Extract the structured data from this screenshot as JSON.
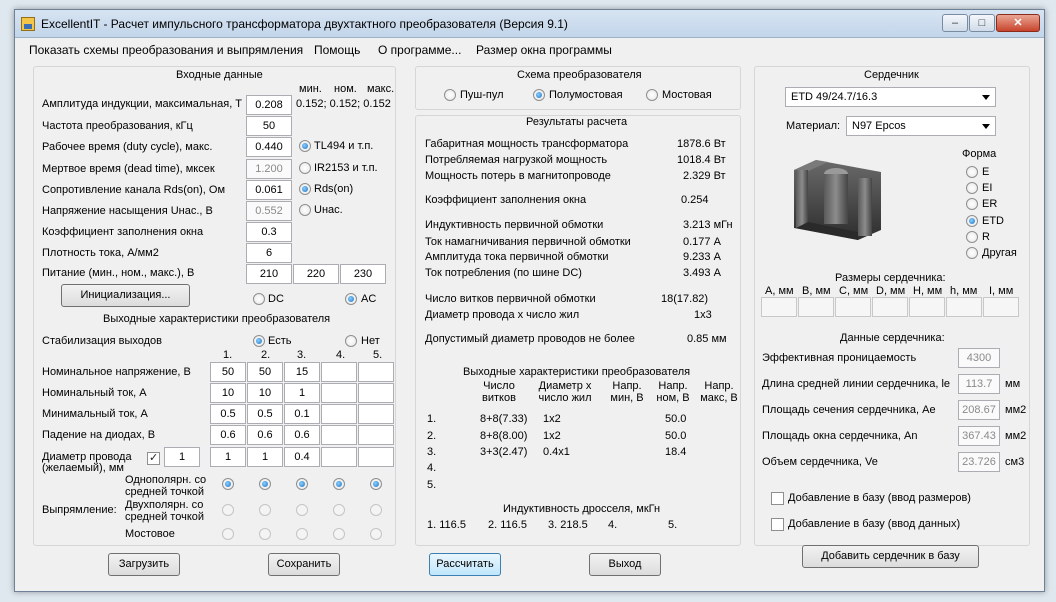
{
  "window": {
    "title": "ExcellentIT - Расчет импульсного трансформатора двухтактного преобразователя (Версия 9.1)"
  },
  "menu": [
    "Показать схемы преобразования и выпрямления",
    "Помощь",
    "О программе...",
    "Размер окна программы"
  ],
  "input": {
    "title": "Входные данные",
    "col_min": "мин.",
    "col_nom": "ном.",
    "col_max": "макс.",
    "rows": [
      {
        "label": "Амплитуда индукции, максимальная, T",
        "value": "0.208",
        "extra": "0.152; 0.152; 0.152"
      },
      {
        "label": "Частота преобразования, кГц",
        "value": "50"
      },
      {
        "label": "Рабочее время (duty cycle), макс.",
        "value": "0.440",
        "option": "TL494 и т.п."
      },
      {
        "label": "Мертвое время (dead time), мксек",
        "value": "1.200",
        "option": "IR2153 и т.п."
      },
      {
        "label": "Сопротивление канала Rds(on), Ом",
        "value": "0.061",
        "option": "Rds(on)"
      },
      {
        "label": "Напряжение насыщения Uнас., В",
        "value": "0.552",
        "option": "Uнас."
      },
      {
        "label": "Коэффициент заполнения окна",
        "value": "0.3"
      },
      {
        "label": "Плотность тока, А/мм2",
        "value": "6"
      }
    ],
    "supply_label": "Питание (мин., ном., макс.), В",
    "supply": [
      "210",
      "220",
      "230"
    ],
    "init_button": "Инициализация...",
    "dc": "DC",
    "ac": "AC"
  },
  "output": {
    "title": "Выходные характеристики преобразователя",
    "stab_label": "Стабилизация выходов",
    "stab_yes": "Есть",
    "stab_no": "Нет",
    "cols": [
      "1.",
      "2.",
      "3.",
      "4.",
      "5."
    ],
    "rows": [
      {
        "label": "Номинальное напряжение, В",
        "values": [
          "50",
          "50",
          "15",
          "",
          ""
        ]
      },
      {
        "label": "Номинальный ток, А",
        "values": [
          "10",
          "10",
          "1",
          "",
          ""
        ]
      },
      {
        "label": "Минимальный ток, А",
        "values": [
          "0.5",
          "0.5",
          "0.1",
          "",
          ""
        ]
      },
      {
        "label": "Падение на диодах, В",
        "values": [
          "0.6",
          "0.6",
          "0.6",
          "",
          ""
        ]
      }
    ],
    "wire_label1": "Диаметр провода",
    "wire_label2": "(желаемый), мм",
    "wire_check": "1",
    "wire_values": [
      "1",
      "1",
      "0.4",
      "",
      ""
    ],
    "rect_label": "Выпрямление:",
    "rect_opt1a": "Однополярн. со",
    "rect_opt1b": "средней точкой",
    "rect_opt2a": "Двухполярн. со",
    "rect_opt2b": "средней точкой",
    "rect_opt3": "Мостовое"
  },
  "scheme": {
    "title": "Схема преобразователя",
    "options": [
      "Пуш-пул",
      "Полумостовая",
      "Мостовая"
    ]
  },
  "results": {
    "title": "Результаты расчета",
    "rows": [
      {
        "label": "Габаритная мощность трансформатора",
        "value": "1878.6 Вт"
      },
      {
        "label": "Потребляемая нагрузкой мощность",
        "value": "1018.4 Вт"
      },
      {
        "label": "Мощность потерь в магнитопроводе",
        "value": "2.329 Вт"
      },
      {
        "label": "Коэффициент заполнения окна",
        "value": "0.254"
      },
      {
        "label": "Индуктивность первичной обмотки",
        "value": "3.213 мГн"
      },
      {
        "label": "Ток намагничивания первичной обмотки",
        "value": "0.177 А"
      },
      {
        "label": "Амплитуда тока первичной обмотки",
        "value": "9.233 А"
      },
      {
        "label": "Ток потребления (по шине DC)",
        "value": "3.493 А"
      },
      {
        "label": "Число витков первичной обмотки",
        "value": "18(17.82)"
      },
      {
        "label": "Диаметр провода х число жил",
        "value": "1х3"
      },
      {
        "label": "Допустимый диаметр проводов не более",
        "value": "0.85 мм"
      }
    ],
    "out_title": "Выходные характеристики преобразователя",
    "out_cols": [
      "Число витков",
      "Диаметр х число жил",
      "Напр. мин, В",
      "Напр. ном, В",
      "Напр. макс, В"
    ],
    "out_rows": [
      {
        "n": "1.",
        "turns": "8+8(7.33)",
        "diam": "1х2",
        "nom": "50.0"
      },
      {
        "n": "2.",
        "turns": "8+8(8.00)",
        "diam": "1х2",
        "nom": "50.0"
      },
      {
        "n": "3.",
        "turns": "3+3(2.47)",
        "diam": "0.4х1",
        "nom": "18.4"
      },
      {
        "n": "4.",
        "turns": "",
        "diam": "",
        "nom": ""
      },
      {
        "n": "5.",
        "turns": "",
        "diam": "",
        "nom": ""
      }
    ],
    "choke_title": "Индуктивность дросселя, мкГн",
    "choke": [
      "1. 116.5",
      "2. 116.5",
      "3. 218.5",
      "4.",
      "5."
    ]
  },
  "core": {
    "title": "Сердечник",
    "selected": "ETD 49/24.7/16.3",
    "material_label": "Материал:",
    "material": "N97 Epcos",
    "shape_label": "Форма",
    "shapes": [
      "E",
      "EI",
      "ER",
      "ETD",
      "R",
      "Другая"
    ],
    "dims_title": "Размеры сердечника:",
    "dims": [
      "A, мм",
      "B, мм",
      "C, мм",
      "D, мм",
      "H, мм",
      "h, мм",
      "I, мм"
    ],
    "data_title": "Данные сердечника:",
    "params": [
      {
        "label": "Эффективная проницаемость",
        "value": "4300",
        "unit": ""
      },
      {
        "label": "Длина средней линии сердечника, le",
        "value": "113.7",
        "unit": "мм"
      },
      {
        "label": "Площадь сечения сердечника, Ae",
        "value": "208.67",
        "unit": "мм2"
      },
      {
        "label": "Площадь окна сердечника, An",
        "value": "367.43",
        "unit": "мм2"
      },
      {
        "label": "Объем сердечника, Ve",
        "value": "23.726",
        "unit": "см3"
      }
    ],
    "add_dims": "Добавление в базу (ввод размеров)",
    "add_data": "Добавление в базу (ввод данных)",
    "add_button": "Добавить сердечник в базу"
  },
  "buttons": {
    "load": "Загрузить",
    "save": "Сохранить",
    "calc": "Рассчитать",
    "exit": "Выход"
  }
}
